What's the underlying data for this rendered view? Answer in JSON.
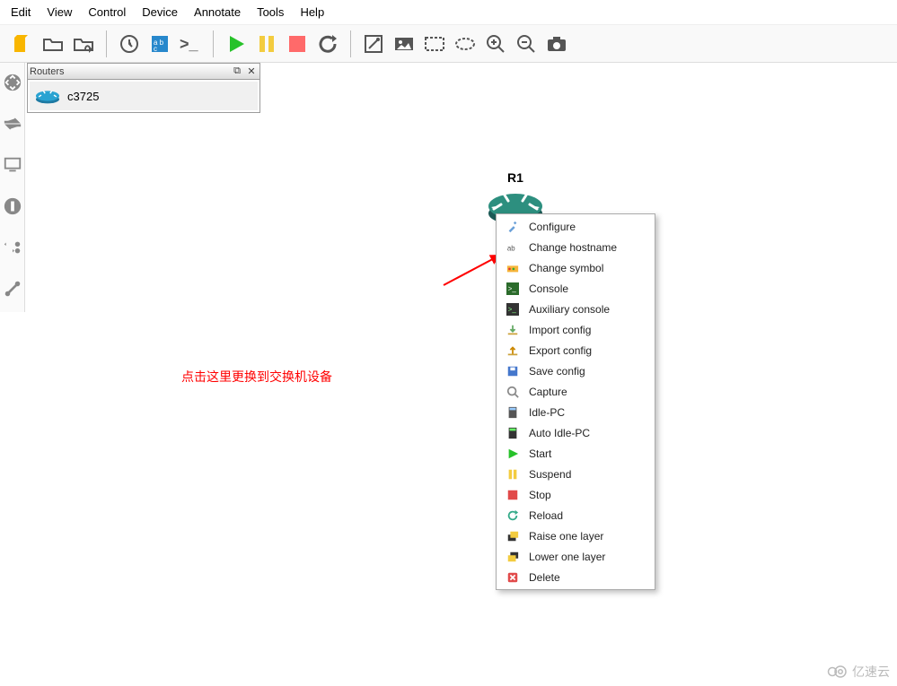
{
  "menubar": [
    "Edit",
    "View",
    "Control",
    "Device",
    "Annotate",
    "Tools",
    "Help"
  ],
  "dock": {
    "title": "Routers",
    "items": [
      {
        "label": "c3725"
      }
    ]
  },
  "canvas": {
    "node_label": "R1",
    "annotation": "点击这里更换到交换机设备"
  },
  "context_menu": [
    {
      "icon": "config",
      "label": "Configure"
    },
    {
      "icon": "hostname",
      "label": "Change hostname"
    },
    {
      "icon": "symbol",
      "label": "Change symbol"
    },
    {
      "icon": "console",
      "label": "Console"
    },
    {
      "icon": "aux",
      "label": "Auxiliary console"
    },
    {
      "icon": "import",
      "label": "Import config"
    },
    {
      "icon": "export",
      "label": "Export config"
    },
    {
      "icon": "save",
      "label": "Save config"
    },
    {
      "icon": "capture",
      "label": "Capture"
    },
    {
      "icon": "idlepc",
      "label": "Idle-PC"
    },
    {
      "icon": "autoidle",
      "label": "Auto Idle-PC"
    },
    {
      "icon": "start",
      "label": "Start"
    },
    {
      "icon": "suspend",
      "label": "Suspend"
    },
    {
      "icon": "stop",
      "label": "Stop"
    },
    {
      "icon": "reload",
      "label": "Reload"
    },
    {
      "icon": "raise",
      "label": "Raise one layer"
    },
    {
      "icon": "lower",
      "label": "Lower one layer"
    },
    {
      "icon": "delete",
      "label": "Delete"
    }
  ],
  "watermark": "亿速云"
}
